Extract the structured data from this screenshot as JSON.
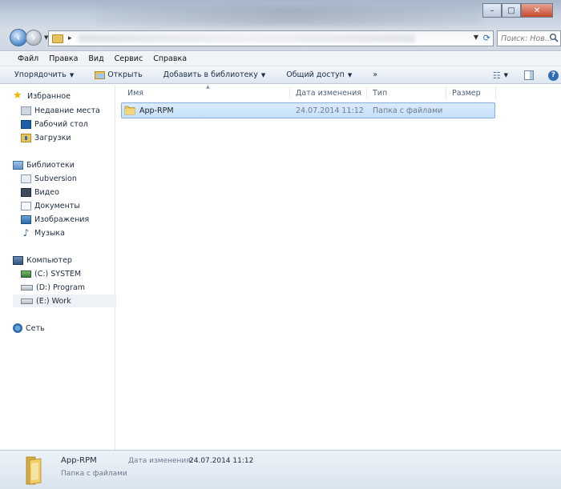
{
  "window": {
    "controls": {
      "minimize": "–",
      "maximize": "□",
      "close": "✕"
    }
  },
  "search": {
    "placeholder": "Поиск: Нов..."
  },
  "menu": {
    "items": [
      "Файл",
      "Правка",
      "Вид",
      "Сервис",
      "Справка"
    ]
  },
  "commands": {
    "organize": "Упорядочить",
    "open": "Открыть",
    "add_to_library": "Добавить в библиотеку",
    "share": "Общий доступ",
    "more": "»"
  },
  "nav": {
    "favorites": "Избранное",
    "recent": "Недавние места",
    "desktop": "Рабочий стол",
    "downloads": "Загрузки",
    "libraries": "Библиотеки",
    "subversion": "Subversion",
    "video": "Видео",
    "documents": "Документы",
    "images": "Изображения",
    "music": "Музыка",
    "computer": "Компьютер",
    "drive_c": "(C:) SYSTEM",
    "drive_d": "(D:) Program",
    "drive_e": "(E:) Work",
    "network": "Сеть"
  },
  "columns": {
    "name": "Имя",
    "modified": "Дата изменения",
    "type": "Тип",
    "size": "Размер"
  },
  "files": [
    {
      "name": "App-RPM",
      "modified": "24.07.2014 11:12",
      "type": "Папка с файлами",
      "size": ""
    }
  ],
  "details": {
    "name": "App-RPM",
    "type": "Папка с файлами",
    "modified_label": "Дата изменения:",
    "modified_value": "24.07.2014 11:12"
  },
  "colors": {
    "selection": "#cce4fb",
    "accent": "#2f6db5"
  }
}
